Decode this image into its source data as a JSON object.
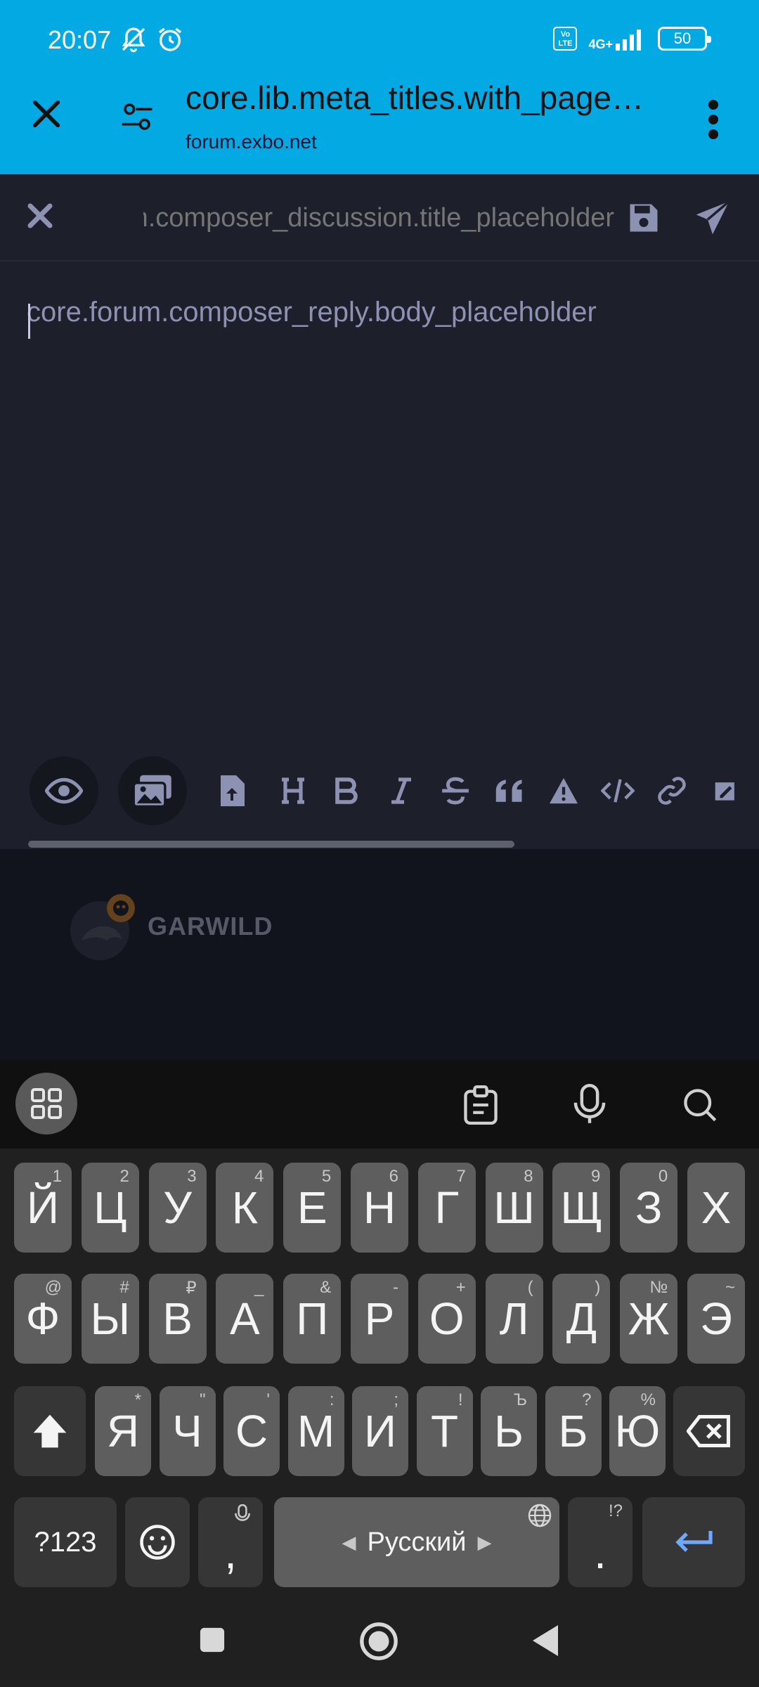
{
  "status_bar": {
    "time": "20:07",
    "network": "4G+",
    "volte": "Vo LTE",
    "battery": "50"
  },
  "browser": {
    "title": "core.lib.meta_titles.with_page…",
    "domain": "forum.exbo.net"
  },
  "composer": {
    "title_placeholder": "core.forum.composer_discussion.title_placeholder",
    "body_placeholder": "core.forum.composer_reply.body_placeholder"
  },
  "logo": {
    "text": "GARWILD"
  },
  "keyboard": {
    "row1": [
      {
        "k": "Й",
        "h": "1"
      },
      {
        "k": "Ц",
        "h": "2"
      },
      {
        "k": "У",
        "h": "3"
      },
      {
        "k": "К",
        "h": "4"
      },
      {
        "k": "Е",
        "h": "5"
      },
      {
        "k": "Н",
        "h": "6"
      },
      {
        "k": "Г",
        "h": "7"
      },
      {
        "k": "Ш",
        "h": "8"
      },
      {
        "k": "Щ",
        "h": "9"
      },
      {
        "k": "З",
        "h": "0"
      },
      {
        "k": "Х",
        "h": ""
      }
    ],
    "row2": [
      {
        "k": "Ф",
        "h": "@"
      },
      {
        "k": "Ы",
        "h": "#"
      },
      {
        "k": "В",
        "h": "₽"
      },
      {
        "k": "А",
        "h": "_"
      },
      {
        "k": "П",
        "h": "&"
      },
      {
        "k": "Р",
        "h": "-"
      },
      {
        "k": "О",
        "h": "+"
      },
      {
        "k": "Л",
        "h": "("
      },
      {
        "k": "Д",
        "h": ")"
      },
      {
        "k": "Ж",
        "h": "№"
      },
      {
        "k": "Э",
        "h": "~"
      }
    ],
    "row3": [
      {
        "k": "Я",
        "h": "*"
      },
      {
        "k": "Ч",
        "h": "\""
      },
      {
        "k": "С",
        "h": "'"
      },
      {
        "k": "М",
        "h": ":"
      },
      {
        "k": "И",
        "h": ";"
      },
      {
        "k": "Т",
        "h": "!"
      },
      {
        "k": "Ь",
        "h": "Ъ"
      },
      {
        "k": "Б",
        "h": "?"
      },
      {
        "k": "Ю",
        "h": "%"
      }
    ],
    "symbols_label": "?123",
    "comma": ",",
    "space_label": "Русский",
    "period": ".",
    "period_hint": "!?"
  }
}
